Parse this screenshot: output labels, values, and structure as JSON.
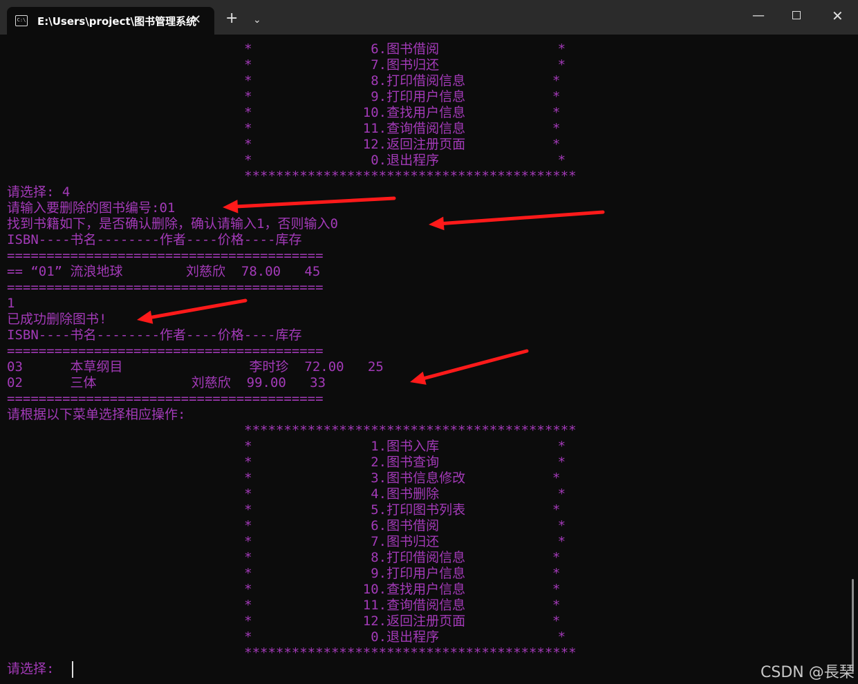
{
  "window": {
    "tab_title": "E:\\Users\\project\\图书管理系统",
    "tab_icon": "console-icon",
    "close_tab_glyph": "✕",
    "new_tab_glyph": "+",
    "dropdown_glyph": "⌄",
    "minimize_glyph": "—",
    "close_glyph": "✕"
  },
  "console": {
    "text_color": "#a33ab8",
    "background": "#0c0c0c",
    "lines": [
      "                              *               6.图书借阅               *",
      "                              *               7.图书归还               *",
      "                              *               8.打印借阅信息           *",
      "                              *               9.打印用户信息           *",
      "                              *              10.查找用户信息           *",
      "                              *              11.查询借阅信息           *",
      "                              *              12.返回注册页面           *",
      "                              *               0.退出程序               *",
      "                              ******************************************",
      "请选择: 4",
      "请输入要删除的图书编号:01",
      "找到书籍如下，是否确认删除，确认请输入1，否则输入0",
      "ISBN----书名--------作者----价格----库存",
      "========================================",
      "== “01” 流浪地球        刘慈欣  78.00   45",
      "========================================",
      "1",
      "已成功删除图书!",
      "ISBN----书名--------作者----价格----库存",
      "========================================",
      "03      本草纲目                李时珍  72.00   25",
      "02      三体            刘慈欣  99.00   33",
      "========================================",
      "请根据以下菜单选择相应操作:",
      "                              ******************************************",
      "                              *               1.图书入库               *",
      "                              *               2.图书查询               *",
      "                              *               3.图书信息修改           *",
      "                              *               4.图书删除               *",
      "                              *               5.打印图书列表           *",
      "                              *               6.图书借阅               *",
      "                              *               7.图书归还               *",
      "                              *               8.打印借阅信息           *",
      "                              *               9.打印用户信息           *",
      "                              *              10.查找用户信息           *",
      "                              *              11.查询借阅信息           *",
      "                              *              12.返回注册页面           *",
      "                              *               0.退出程序               *",
      "                              ******************************************",
      "请选择: "
    ]
  },
  "annotation_color": "#ff1a1a",
  "watermark": "CSDN @長琹"
}
